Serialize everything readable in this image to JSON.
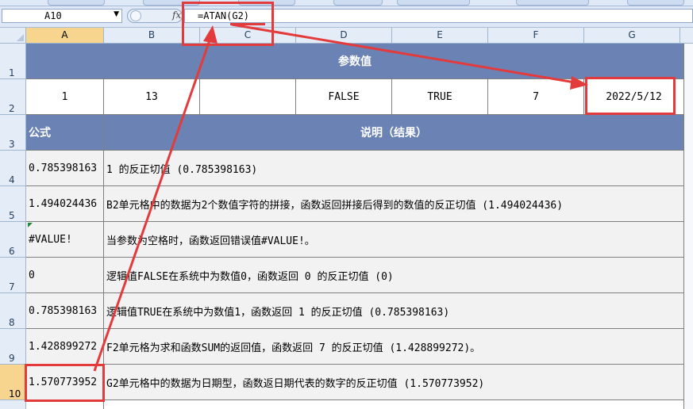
{
  "formula_bar": {
    "name_box": "A10",
    "fx_label": "fx",
    "formula": "=ATAN(G2)"
  },
  "columns": [
    "A",
    "B",
    "C",
    "D",
    "E",
    "F",
    "G"
  ],
  "rows": [
    "1",
    "2",
    "3",
    "4",
    "5",
    "6",
    "7",
    "8",
    "9",
    "10"
  ],
  "sheet": {
    "title": "参数值",
    "params": [
      "1",
      "13",
      "",
      "FALSE",
      "TRUE",
      "7",
      "2022/5/12"
    ],
    "header_formula": "公式",
    "header_desc": "说明（结果）",
    "results": [
      {
        "value": "0.785398163",
        "desc": "1 的反正切值 (0.785398163)"
      },
      {
        "value": "1.494024436",
        "desc": "B2单元格中的数据为2个数值字符的拼接，函数返回拼接后得到的数值的反正切值 (1.494024436)"
      },
      {
        "value": "#VALUE!",
        "desc": "当参数为空格时，函数返回错误值#VALUE!。"
      },
      {
        "value": "0",
        "desc": "逻辑值FALSE在系统中为数值0，函数返回 0 的反正切值 (0)"
      },
      {
        "value": "0.785398163",
        "desc": "逻辑值TRUE在系统中为数值1，函数返回 1 的反正切值 (0.785398163)"
      },
      {
        "value": "1.428899272",
        "desc": "F2单元格为求和函数SUM的返回值，函数返回 7 的反正切值 (1.428899272)。"
      },
      {
        "value": "1.570773952",
        "desc": "G2单元格中的数据为日期型，函数返日期代表的数字的反正切值 (1.570773952)"
      }
    ]
  },
  "colors": {
    "header_fill": "#6b82b4",
    "annotation_red": "#e33b3b",
    "selected_header": "#f8d58f"
  }
}
